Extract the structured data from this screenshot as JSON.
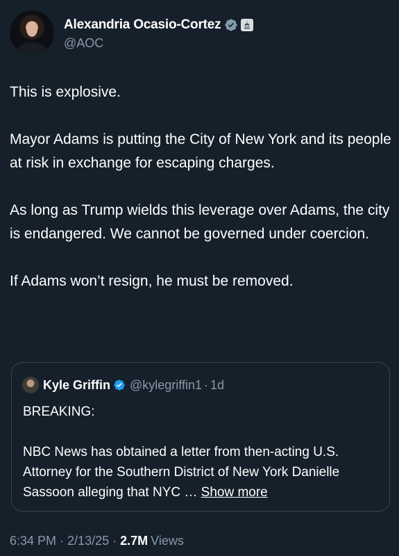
{
  "author": {
    "display_name": "Alexandria Ocasio-Cortez",
    "handle": "@AOC",
    "verified_icon": "verified-badge-icon",
    "affiliation_icon": "government-capitol-icon"
  },
  "tweet": {
    "paragraphs": [
      "This is explosive.",
      "Mayor Adams is putting the City of New York and its people at risk in exchange for escaping charges.",
      "As long as Trump wields this leverage over Adams, the city is endangered. We cannot be governed under coercion.",
      "If Adams won’t resign, he must be removed."
    ]
  },
  "quote": {
    "display_name": "Kyle Griffin",
    "handle": "@kylegriffin1",
    "separator": "·",
    "time": "1d",
    "paragraphs": [
      "BREAKING:",
      "NBC News has obtained a letter from then-acting U.S. Attorney for the Southern District of New York Danielle Sassoon alleging that NYC …"
    ],
    "show_more": "Show more"
  },
  "meta": {
    "time": "6:34 PM",
    "dot1": "·",
    "date": "2/13/25",
    "dot2": "·",
    "views_count": "2.7M",
    "views_label": "Views"
  },
  "colors": {
    "background": "#15202b",
    "text": "#ffffff",
    "secondary": "#8b98a5",
    "border": "#38444d",
    "verified": "#829aab"
  }
}
